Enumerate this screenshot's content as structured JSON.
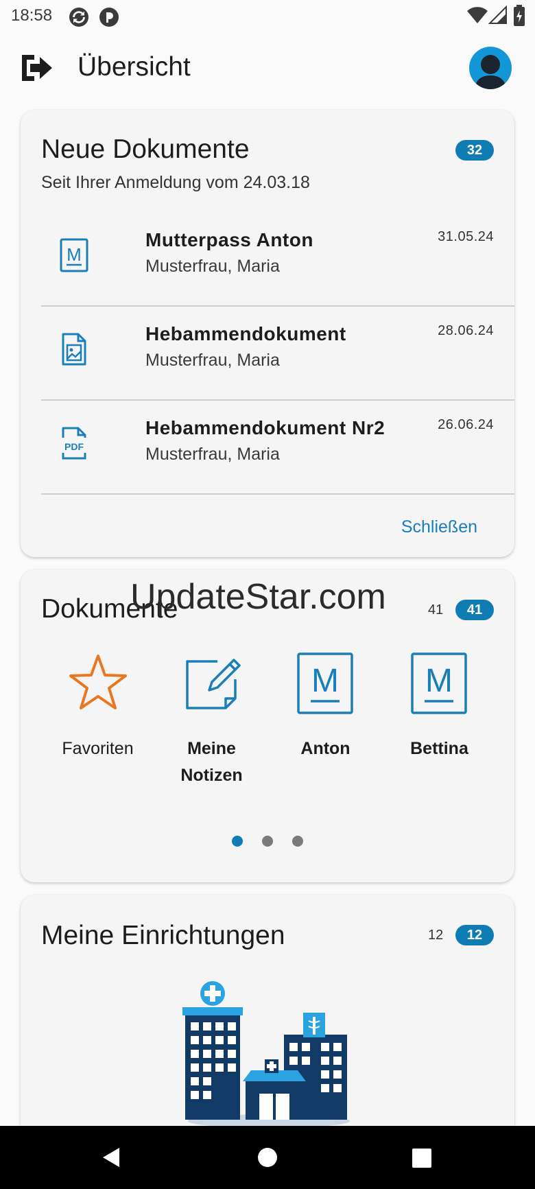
{
  "status_bar": {
    "time": "18:58",
    "icons": [
      "sync-icon",
      "app-notification-icon",
      "wifi-icon",
      "signal-icon",
      "battery-icon"
    ]
  },
  "app_bar": {
    "title": "Übersicht",
    "left_icon": "logout-icon",
    "right_icon": "avatar"
  },
  "new_documents": {
    "title": "Neue Dokumente",
    "badge": "32",
    "subtitle": "Seit Ihrer Anmeldung vom 24.03.18",
    "items": [
      {
        "title": "Mutterpass Anton",
        "subtitle": "Musterfrau, Maria",
        "date": "31.05.24",
        "icon": "mutterpass-icon"
      },
      {
        "title": "Hebammendokument",
        "subtitle": "Musterfrau, Maria",
        "date": "28.06.24",
        "icon": "image-document-icon"
      },
      {
        "title": "Hebammendokument Nr2",
        "subtitle": "Musterfrau, Maria",
        "date": "26.06.24",
        "icon": "pdf-document-icon"
      }
    ],
    "close_label": "Schließen"
  },
  "documents": {
    "title": "Dokumente",
    "count": "41",
    "badge": "41",
    "folders": [
      {
        "line1": "Favoriten",
        "line2": "",
        "icon": "star-icon"
      },
      {
        "line1": "Meine",
        "line2": "Notizen",
        "icon": "note-edit-icon"
      },
      {
        "line1": "Anton",
        "line2": "",
        "icon": "mutterpass-icon"
      },
      {
        "line1": "Bettina",
        "line2": "",
        "icon": "mutterpass-icon"
      }
    ],
    "page_count": 3,
    "active_page": 1
  },
  "facilities": {
    "title": "Meine Einrichtungen",
    "count": "12",
    "badge": "12",
    "illustration": "hospital-illustration"
  },
  "watermark": "UpdateStar.com",
  "nav_bar": [
    "back-icon",
    "home-icon",
    "recents-icon"
  ],
  "colors": {
    "accent": "#0f7cb4",
    "icon_blue": "#1a7fb8",
    "star_orange": "#e87722",
    "hospital_dark": "#123a66",
    "hospital_light": "#2ba3e0"
  }
}
